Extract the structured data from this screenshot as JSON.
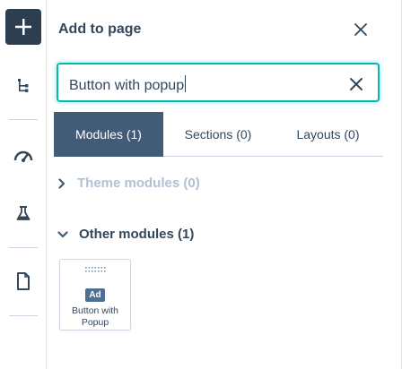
{
  "rail": {
    "add_icon": "plus-icon",
    "items": [
      {
        "name": "tree-icon"
      },
      {
        "name": "gauge-icon"
      },
      {
        "name": "flask-icon"
      },
      {
        "name": "page-icon"
      }
    ]
  },
  "panel": {
    "title": "Add to page",
    "close_icon": "close-icon"
  },
  "search": {
    "value": "Button with popup",
    "clear_icon": "clear-icon"
  },
  "tabs": [
    {
      "label": "Modules (1)",
      "active": true
    },
    {
      "label": "Sections (0)",
      "active": false
    },
    {
      "label": "Layouts (0)",
      "active": false
    }
  ],
  "groups": {
    "theme": {
      "label": "Theme modules (0)",
      "expanded": false
    },
    "other": {
      "label": "Other modules (1)",
      "expanded": true
    }
  },
  "modules": [
    {
      "badge": "Ad",
      "label_line1": "Button with",
      "label_line2": "Popup"
    }
  ],
  "colors": {
    "accent": "#00bda5",
    "active_tab": "#425b76",
    "rail_button": "#2d3e50",
    "text": "#33475b",
    "muted_text": "#b0c1d4"
  }
}
